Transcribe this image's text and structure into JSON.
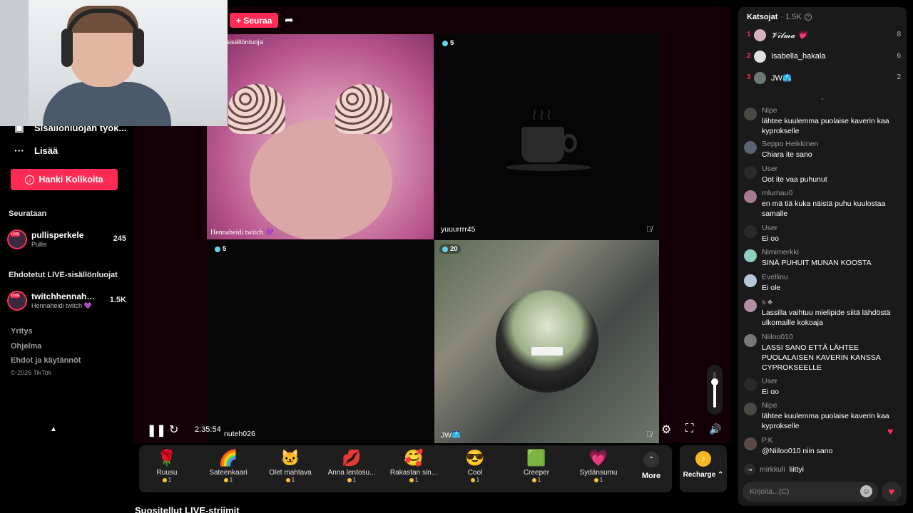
{
  "sidebar": {
    "creator_tools": "Sisällönluojan työk...",
    "more": "Lisää",
    "coins_button": "Hanki Kolikoita",
    "following_title": "Seurataan",
    "following": [
      {
        "name": "pullisperkele",
        "sub": "Pullis",
        "count": "245"
      }
    ],
    "suggested_title": "Ehdotetut LIVE-sisällönluojat",
    "suggested": [
      {
        "name": "twitchhennaheidi",
        "sub": "Hennaheidi twitch 💜",
        "count": "1.5K"
      }
    ],
    "footer": [
      "Yritys",
      "Ohjelma",
      "Ehdot ja käytännöt"
    ],
    "copyright": "© 2026 TikTok"
  },
  "stage": {
    "follow_button": "+ Seuraa",
    "tiles": [
      {
        "label": "-sisällönluoja",
        "name": "Hennaheidi twitch 💜",
        "viewers": ""
      },
      {
        "label": "",
        "name": "yuuurrrr45",
        "viewers": "5"
      },
      {
        "label": "",
        "name": "nuteh026",
        "viewers": "5"
      },
      {
        "label": "",
        "name": "JW🩳",
        "viewers": "20"
      }
    ],
    "timer": "2:35:54"
  },
  "gifts": [
    {
      "name": "Ruusu",
      "price": "1",
      "icon": "🌹"
    },
    {
      "name": "Sateenkaari",
      "price": "1",
      "icon": "🌈"
    },
    {
      "name": "Olet mahtava",
      "price": "1",
      "icon": "🐱"
    },
    {
      "name": "Anna lentosu...",
      "price": "1",
      "icon": "💋"
    },
    {
      "name": "Rakastan sin...",
      "price": "1",
      "icon": "🥰"
    },
    {
      "name": "Cool",
      "price": "1",
      "icon": "😎"
    },
    {
      "name": "Creeper",
      "price": "1",
      "icon": "🟩"
    },
    {
      "name": "Sydänsumu",
      "price": "1",
      "icon": "💗"
    }
  ],
  "gift_more": "More",
  "recharge": "Recharge ⌃",
  "recommended_title": "Suositellut LIVE-striimit",
  "chat": {
    "title": "Katsojat",
    "viewer_count": "· 1.5K",
    "top_viewers": [
      {
        "rank": "1",
        "name": "𝓥𝓲𝓵𝓶𝓪 💗",
        "value": "8"
      },
      {
        "rank": "2",
        "name": "Isabella_hakala",
        "value": "6"
      },
      {
        "rank": "3",
        "name": "JW🩳",
        "value": "2"
      }
    ],
    "messages": [
      {
        "user": "Nipe",
        "text": "lähtee kuulemma puolaise kaverin kaa kyprokselle"
      },
      {
        "user": "Seppo Heikkinen",
        "text": "Chiara ite sano"
      },
      {
        "user": "User",
        "text": "Oot ite vaa puhunut"
      },
      {
        "user": "mlumau0",
        "text": "en mä tiä kuka näistä puhu kuulostaa samalle"
      },
      {
        "user": "User",
        "text": "Ei oo"
      },
      {
        "user": "Nimimerkki",
        "text": "SINÄ PUHUIT MUNAN KOOSTA"
      },
      {
        "user": "Evellinu",
        "text": "Ei ole"
      },
      {
        "user": "s ♣",
        "text": "Lassilla vaihtuu mielipide siitä lähdöstä ulkomaille kokoaja"
      },
      {
        "user": "Niiloo010",
        "text": "LASSI SANO ETTÄ LÄHTEE PUOLALAISEN KAVERIN KANSSA CYPROKSEELLE"
      },
      {
        "user": "User",
        "text": "Ei oo"
      },
      {
        "user": "Nipe",
        "text": "lähtee kuulemma puolaise kaverin kaa kyprokselle"
      },
      {
        "user": "P.K",
        "text": "@Niiloo010 niin sano"
      }
    ],
    "joined_user": "mirkkuli",
    "joined_text": "liittyi",
    "input_placeholder": "Kirjoita...(C)"
  }
}
